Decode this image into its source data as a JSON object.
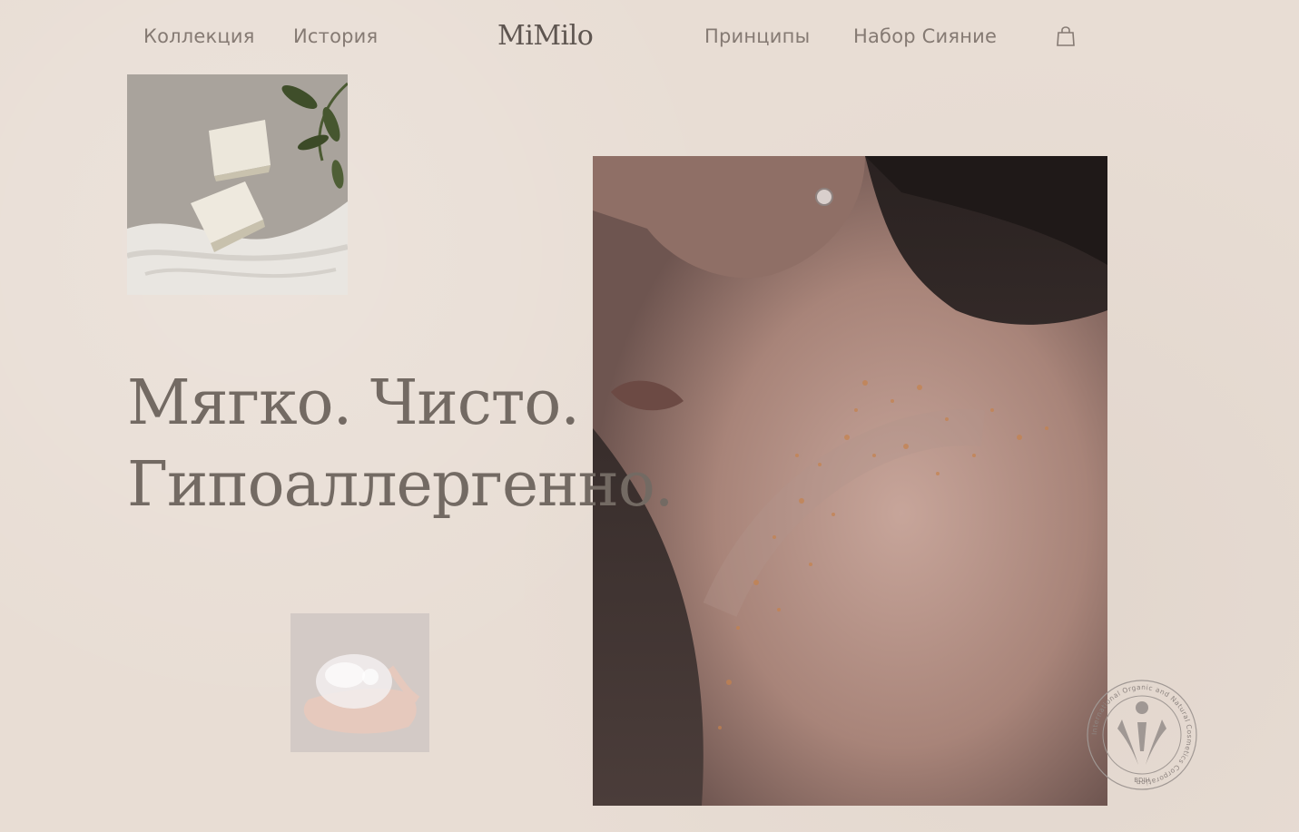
{
  "nav": {
    "left": [
      "Коллекция",
      "История"
    ],
    "logo": "MiMilo",
    "right": [
      "Принципы",
      "Набор Сияние"
    ],
    "cart_icon": "shopping-bag-icon"
  },
  "hero": {
    "line1": "Мягко. Чисто.",
    "line2": "Гипоаллергенно."
  },
  "photos": {
    "soap": "soap-bars-photo",
    "woman": "woman-shoulder-freckles-photo",
    "hand": "hand-with-foam-photo"
  },
  "badge": {
    "ring_text": "International Organic and Natural Cosmetics Corporation",
    "code": "BDIH"
  },
  "colors": {
    "background": "#e8ddd4",
    "text": "#736a63",
    "nav_text": "#857a73"
  }
}
